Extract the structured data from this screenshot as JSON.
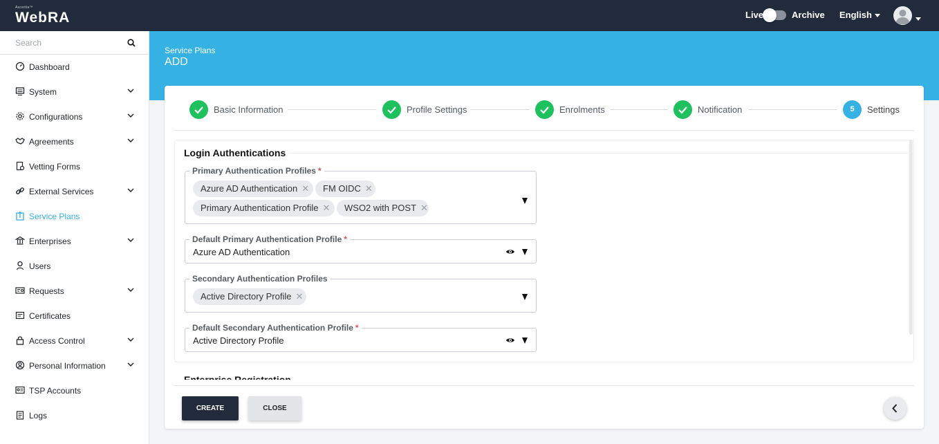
{
  "header": {
    "logo_small": "Ascertia™",
    "logo_main": "WebRA",
    "live_label": "Live",
    "archive_label": "Archive",
    "language": "English"
  },
  "sidebar": {
    "search_placeholder": "Search",
    "items": [
      {
        "label": "Dashboard",
        "icon": "dashboard-icon",
        "has_children": false
      },
      {
        "label": "System",
        "icon": "monitor-icon",
        "has_children": true
      },
      {
        "label": "Configurations",
        "icon": "gear-icon",
        "has_children": true
      },
      {
        "label": "Agreements",
        "icon": "handshake-icon",
        "has_children": true
      },
      {
        "label": "Vetting Forms",
        "icon": "form-icon",
        "has_children": false
      },
      {
        "label": "External Services",
        "icon": "link-icon",
        "has_children": true
      },
      {
        "label": "Service Plans",
        "icon": "plan-icon",
        "has_children": false,
        "active": true
      },
      {
        "label": "Enterprises",
        "icon": "bank-icon",
        "has_children": true
      },
      {
        "label": "Users",
        "icon": "users-icon",
        "has_children": false
      },
      {
        "label": "Requests",
        "icon": "requests-icon",
        "has_children": true
      },
      {
        "label": "Certificates",
        "icon": "certificate-icon",
        "has_children": false
      },
      {
        "label": "Access Control",
        "icon": "lock-icon",
        "has_children": true
      },
      {
        "label": "Personal Information",
        "icon": "person-icon",
        "has_children": true
      },
      {
        "label": "TSP Accounts",
        "icon": "id-card-icon",
        "has_children": false
      },
      {
        "label": "Logs",
        "icon": "logs-icon",
        "has_children": false
      }
    ]
  },
  "page": {
    "breadcrumb": "Service Plans",
    "title": "ADD"
  },
  "stepper": {
    "steps": [
      {
        "label": "Basic Information",
        "status": "done"
      },
      {
        "label": "Profile Settings",
        "status": "done"
      },
      {
        "label": "Enrolments",
        "status": "done"
      },
      {
        "label": "Notification",
        "status": "done"
      },
      {
        "label": "Settings",
        "status": "current",
        "number": "5"
      }
    ]
  },
  "form": {
    "section_title": "Login Authentications",
    "next_section_title": "Enterprise Registration",
    "primary_profiles": {
      "label": "Primary Authentication Profiles",
      "required": "*",
      "chips": [
        "Azure AD Authentication",
        "FM OIDC",
        "Primary Authentication Profile",
        "WSO2 with POST"
      ]
    },
    "default_primary": {
      "label": "Default Primary Authentication Profile",
      "required": "*",
      "value": "Azure AD Authentication"
    },
    "secondary_profiles": {
      "label": "Secondary Authentication Profiles",
      "chips": [
        "Active Directory Profile"
      ]
    },
    "default_secondary": {
      "label": "Default Secondary Authentication Profile",
      "required": "*",
      "value": "Active Directory Profile"
    },
    "chip_remove_glyph": "✕"
  },
  "actions": {
    "create_label": "CREATE",
    "close_label": "CLOSE"
  },
  "colors": {
    "topbar": "#212b3b",
    "accent": "#36b1e4",
    "step_done": "#1ec15e",
    "required": "#d9534f"
  }
}
